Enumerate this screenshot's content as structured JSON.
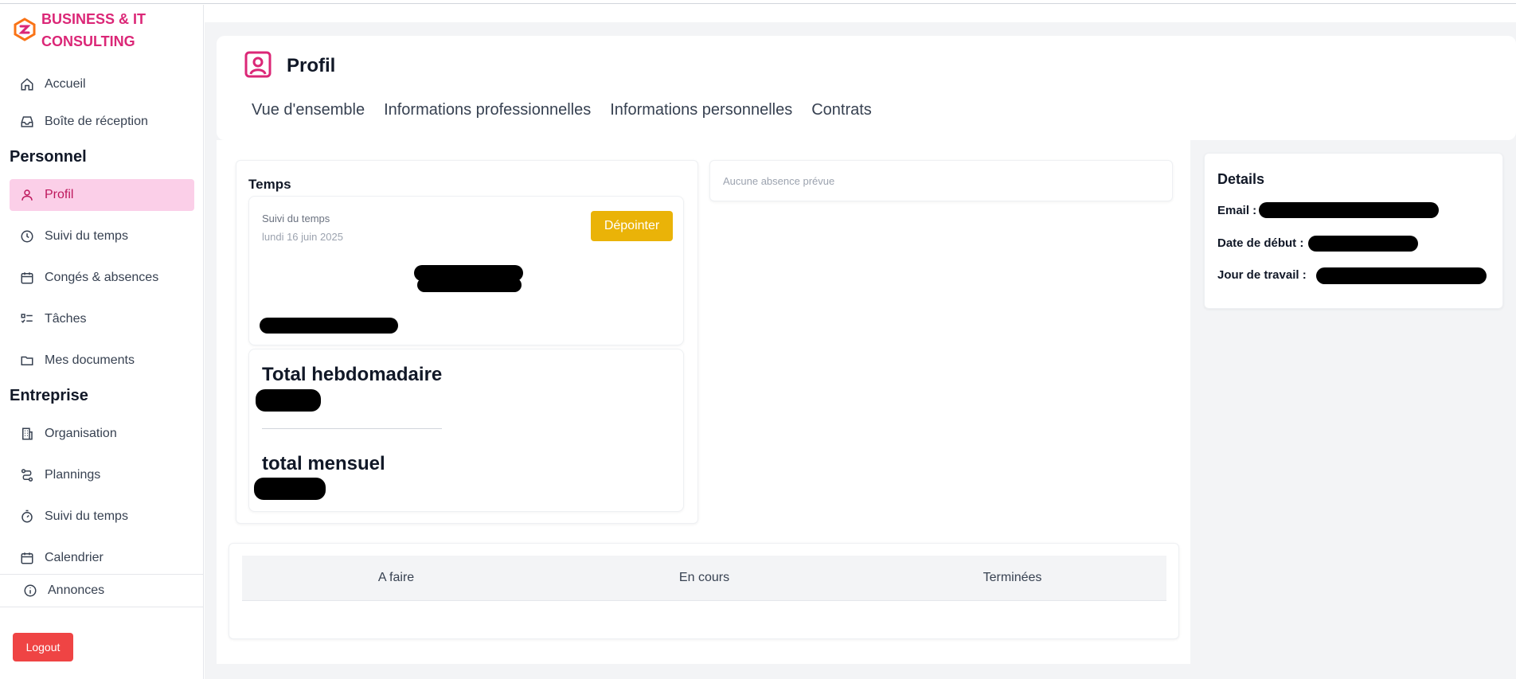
{
  "brand": {
    "name": "BUSINESS & IT CONSULTING",
    "color": "#db2777"
  },
  "sidebar": {
    "top_items": [
      {
        "label": "Accueil",
        "icon": "home-icon"
      },
      {
        "label": "Boîte de réception",
        "icon": "inbox-icon"
      }
    ],
    "section_personnel": "Personnel",
    "personnel_items": [
      {
        "label": "Profil",
        "icon": "user-icon",
        "active": true
      },
      {
        "label": "Suivi du temps",
        "icon": "clock-icon"
      },
      {
        "label": "Congés & absences",
        "icon": "calendar-icon"
      },
      {
        "label": "Tâches",
        "icon": "task-list-icon"
      },
      {
        "label": "Mes documents",
        "icon": "folder-icon"
      }
    ],
    "section_entreprise": "Entreprise",
    "entreprise_items": [
      {
        "label": "Organisation",
        "icon": "building-icon"
      },
      {
        "label": "Plannings",
        "icon": "route-icon"
      },
      {
        "label": "Suivi du temps",
        "icon": "timer-icon"
      },
      {
        "label": "Calendrier",
        "icon": "calendar-icon"
      }
    ],
    "annonces": {
      "label": "Annonces",
      "icon": "info-icon"
    },
    "logout_label": "Logout"
  },
  "header": {
    "title": "Profil",
    "icon": "profile-card-icon",
    "tabs": [
      "Vue d'ensemble",
      "Informations professionnelles",
      "Informations personnelles",
      "Contrats"
    ]
  },
  "temps": {
    "title": "Temps",
    "suivi_label": "Suivi du temps",
    "date": "lundi 16 juin 2025",
    "depointer_label": "Dépointer",
    "total_hebdo_label": "Total hebdomadaire",
    "total_mensuel_label": "total mensuel"
  },
  "absence": {
    "text": "Aucune absence prévue"
  },
  "tasks": {
    "columns": [
      "A faire",
      "En cours",
      "Terminées"
    ]
  },
  "details": {
    "title": "Details",
    "email_label": "Email :",
    "date_debut_label": "Date de début :",
    "jour_travail_label": "Jour de travail :"
  },
  "colors": {
    "accent": "#db2777",
    "active_bg": "#fbcfe8",
    "button_yellow": "#eab308",
    "logout_red": "#ef4444"
  }
}
